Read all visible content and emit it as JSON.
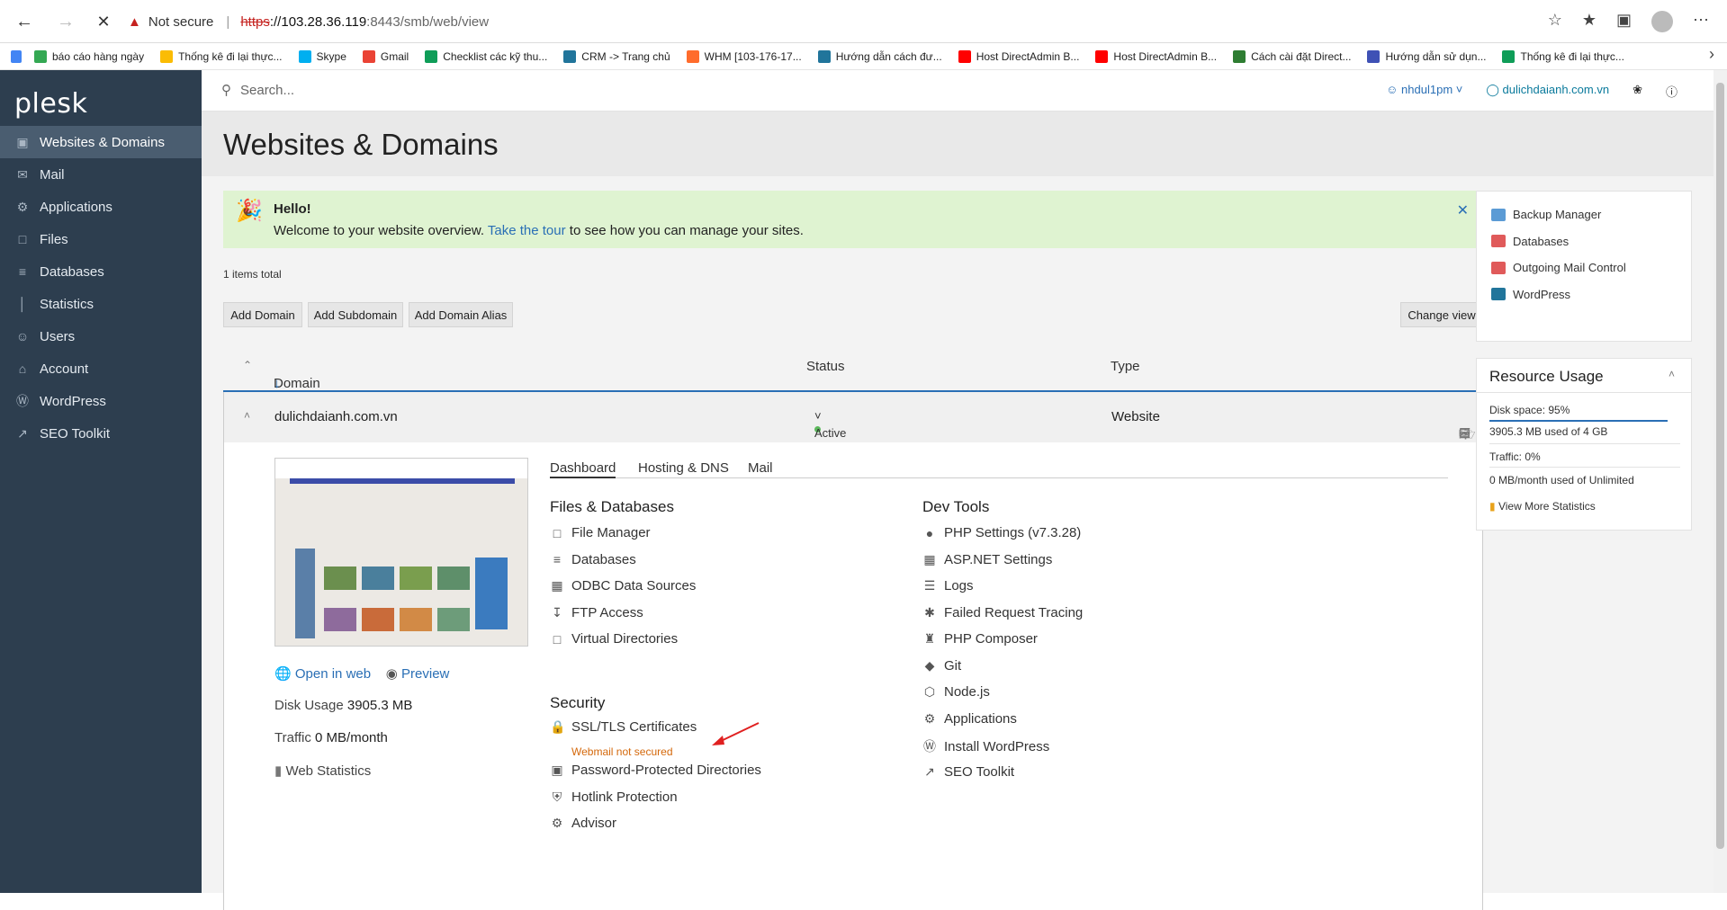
{
  "browser": {
    "not_secure": "Not secure",
    "url_https": "https",
    "url_host": "://103.28.36.119",
    "url_path": ":8443/smb/web/view",
    "back_icon": "arrow-left-icon",
    "forward_icon": "arrow-right-icon",
    "stop_icon": "close-icon",
    "bookmarks": [
      {
        "label": "báo cáo hàng ngày",
        "color": "#34a853"
      },
      {
        "label": "Thống kê đi lại thực...",
        "color": "#fbbc04"
      },
      {
        "label": "Skype",
        "color": "#00aff0"
      },
      {
        "label": "Gmail",
        "color": "#ea4335"
      },
      {
        "label": "Checklist các kỹ thu...",
        "color": "#0f9d58"
      },
      {
        "label": "CRM -> Trang chủ",
        "color": "#21759b"
      },
      {
        "label": "WHM [103-176-17...",
        "color": "#ff6c2c"
      },
      {
        "label": "Hướng dẫn cách đư...",
        "color": "#21759b"
      },
      {
        "label": "Host DirectAdmin B...",
        "color": "#ff0000"
      },
      {
        "label": "Host DirectAdmin B...",
        "color": "#ff0000"
      },
      {
        "label": "Cách cài đặt Direct...",
        "color": "#2e7d32"
      },
      {
        "label": "Hướng dẫn sử dụn...",
        "color": "#3f51b5"
      },
      {
        "label": "Thống kê đi lại thực...",
        "color": "#0f9d58"
      }
    ]
  },
  "sidebar": {
    "logo": "plesk",
    "items": [
      {
        "label": "Websites & Domains",
        "icon": "monitor-icon"
      },
      {
        "label": "Mail",
        "icon": "mail-icon"
      },
      {
        "label": "Applications",
        "icon": "gear-icon"
      },
      {
        "label": "Files",
        "icon": "folder-icon"
      },
      {
        "label": "Databases",
        "icon": "database-icon"
      },
      {
        "label": "Statistics",
        "icon": "chart-icon"
      },
      {
        "label": "Users",
        "icon": "user-icon"
      },
      {
        "label": "Account",
        "icon": "account-icon"
      },
      {
        "label": "WordPress",
        "icon": "wordpress-icon"
      },
      {
        "label": "SEO Toolkit",
        "icon": "seo-icon"
      }
    ]
  },
  "topbar": {
    "search_placeholder": "Search...",
    "user": "nhdul1pm",
    "domain": "dulichdaianh.com.vn"
  },
  "page_title": "Websites & Domains",
  "hello": {
    "title": "Hello!",
    "msg_before": "Welcome to your website overview. ",
    "tour_link": "Take the tour",
    "msg_after": " to see how you can manage your sites."
  },
  "items_total": "1 items total",
  "buttons": {
    "add_domain": "Add Domain",
    "add_subdomain": "Add Subdomain",
    "add_alias": "Add Domain Alias",
    "change_view": "Change view"
  },
  "table": {
    "col_domain": "Domain name",
    "sort_arrow": "↓",
    "col_status": "Status",
    "col_type": "Type",
    "domain": "dulichdaianh.com.vn",
    "status": "Active",
    "type": "Website"
  },
  "site": {
    "open_in_web": "Open in web",
    "preview": "Preview",
    "disk_usage_label": "Disk Usage",
    "disk_usage_value": "3905.3 MB",
    "traffic_label": "Traffic",
    "traffic_value": "0 MB/month",
    "web_statistics": "Web Statistics"
  },
  "tabs": [
    "Dashboard",
    "Hosting & DNS",
    "Mail"
  ],
  "sections": {
    "files_db": "Files & Databases",
    "security": "Security",
    "dev_tools": "Dev Tools"
  },
  "files_tools": [
    "File Manager",
    "Databases",
    "ODBC Data Sources",
    "FTP Access",
    "Virtual Directories"
  ],
  "security_tools": {
    "ssl": "SSL/TLS Certificates",
    "ssl_warning": "Webmail not secured",
    "others": [
      "Password-Protected Directories",
      "Hotlink Protection",
      "Advisor"
    ]
  },
  "dev_tools": [
    "PHP Settings (v7.3.28)",
    "ASP.NET Settings",
    "Logs",
    "Failed Request Tracing",
    "PHP Composer",
    "Git",
    "Node.js",
    "Applications",
    "Install WordPress",
    "SEO Toolkit"
  ],
  "right_links": [
    "Backup Manager",
    "Databases",
    "Outgoing Mail Control",
    "WordPress"
  ],
  "resource": {
    "title": "Resource Usage",
    "disk": "Disk space: 95%",
    "disk_detail": "3905.3 MB used of 4 GB",
    "traffic": "Traffic: 0%",
    "traffic_detail": "0 MB/month used of Unlimited",
    "more": "View More Statistics",
    "disk_fraction": 0.95
  },
  "colors": {
    "sidebar": "#2d3e4f",
    "accent": "#2a6fb5",
    "warning": "#d4680b",
    "hello_bg": "#dff3d1"
  }
}
